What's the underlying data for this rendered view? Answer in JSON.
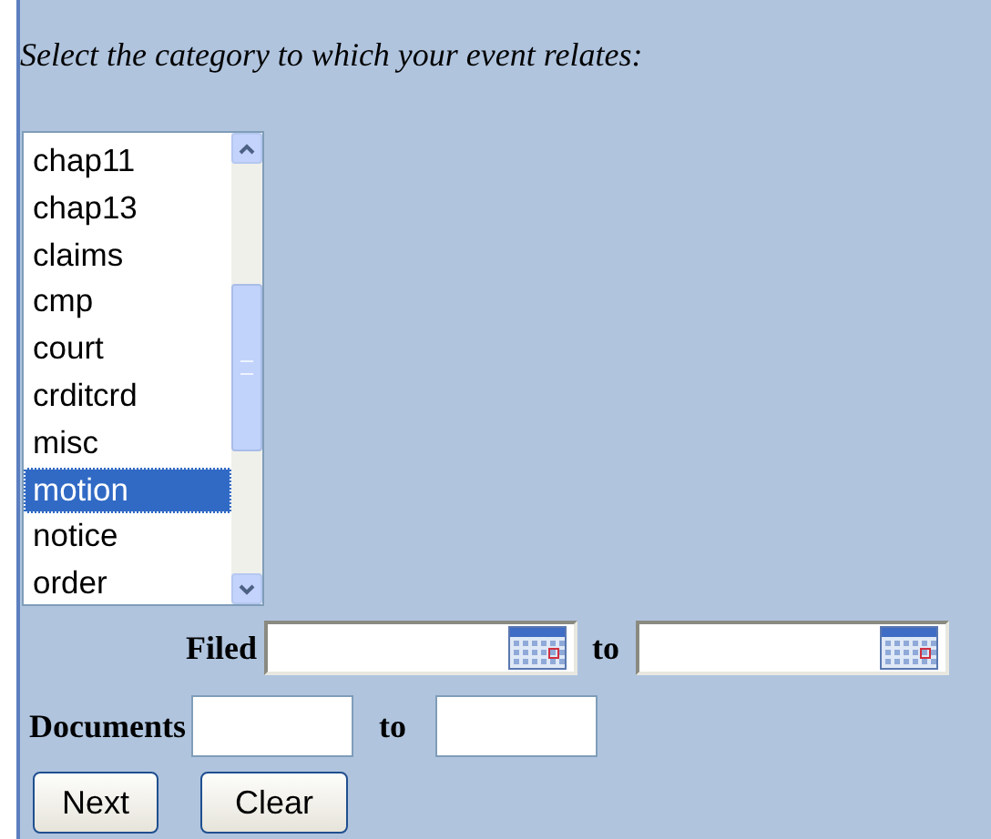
{
  "prompt": "Select the category to which your event relates:",
  "categories": [
    {
      "label": "chap11",
      "selected": false
    },
    {
      "label": "chap13",
      "selected": false
    },
    {
      "label": "claims",
      "selected": false
    },
    {
      "label": "cmp",
      "selected": false
    },
    {
      "label": "court",
      "selected": false
    },
    {
      "label": "crditcrd",
      "selected": false
    },
    {
      "label": "misc",
      "selected": false
    },
    {
      "label": "motion",
      "selected": true
    },
    {
      "label": "notice",
      "selected": false
    },
    {
      "label": "order",
      "selected": false
    }
  ],
  "filed": {
    "label": "Filed",
    "separator": "to"
  },
  "documents": {
    "label": "Documents",
    "separator": "to"
  },
  "buttons": [
    "Next",
    "Clear"
  ]
}
